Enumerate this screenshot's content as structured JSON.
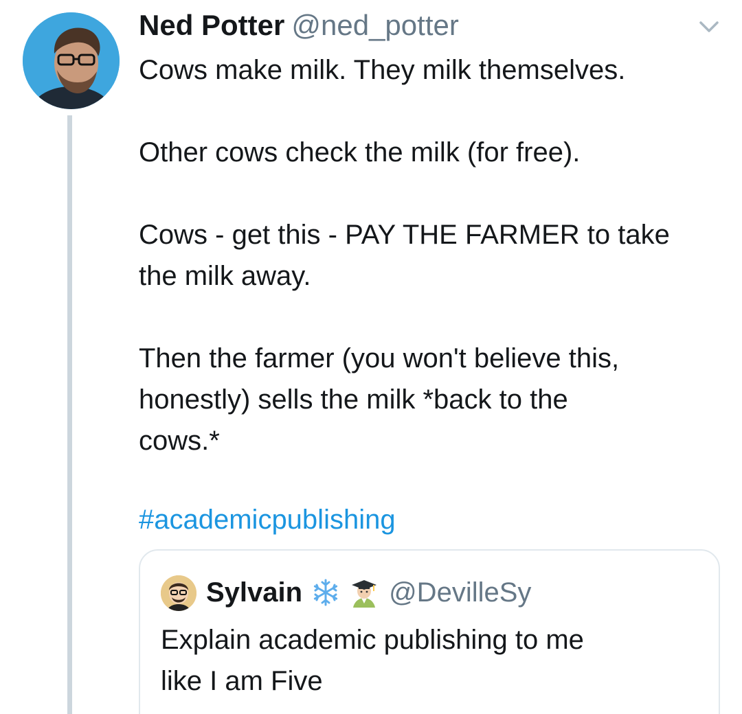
{
  "tweet": {
    "author": {
      "name": "Ned Potter",
      "handle": "@ned_potter"
    },
    "paragraphs": [
      [
        "Cows make milk. They milk themselves."
      ],
      [
        "Other cows check the milk (for free)."
      ],
      [
        "Cows - get this - PAY THE FARMER to take",
        "the milk away."
      ],
      [
        "Then the farmer (you won't believe this,",
        "honestly) sells the milk *back to the",
        "cows.*"
      ]
    ],
    "hashtag": "#academicpublishing",
    "menu_icon": "chevron-down-icon",
    "colors": {
      "link": "#1b95e0",
      "handle": "#657786",
      "thread_line": "#ccd6dd",
      "card_border": "#e1e8ed"
    }
  },
  "quoted_tweet": {
    "author": {
      "name": "Sylvain",
      "handle": "@DevilleSy",
      "name_emojis": [
        "snowflake-icon",
        "graduate-icon"
      ]
    },
    "lines": [
      "Explain academic publishing to me",
      "like I am Five"
    ]
  }
}
